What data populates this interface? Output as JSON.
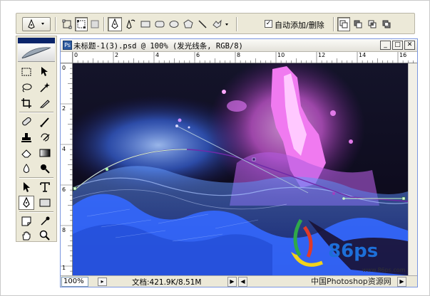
{
  "options_bar": {
    "auto_add_delete_checked": true,
    "auto_add_delete_label": "自动添加/删除"
  },
  "document": {
    "title": "未标题-1(3).psd @ 100% (发光线条, RGB/8)",
    "zoom": "100%",
    "doc_info": "文档:421.9K/8.51M",
    "ruler_h": [
      "0",
      "2",
      "4",
      "6",
      "8",
      "10",
      "12",
      "14",
      "16"
    ],
    "ruler_v": [
      "0",
      "2",
      "4",
      "6",
      "8",
      "1"
    ]
  },
  "watermark": {
    "logo_text": "86ps",
    "url": "www.86ps.com",
    "caption": "中国Photoshop资源网"
  },
  "colors": {
    "ui_bg": "#ece9d8",
    "selection_blue": "#0a246a",
    "canvas_dark": "#0a0a1c",
    "glow_magenta": "#e060e8",
    "glow_blue": "#3f74ff"
  }
}
